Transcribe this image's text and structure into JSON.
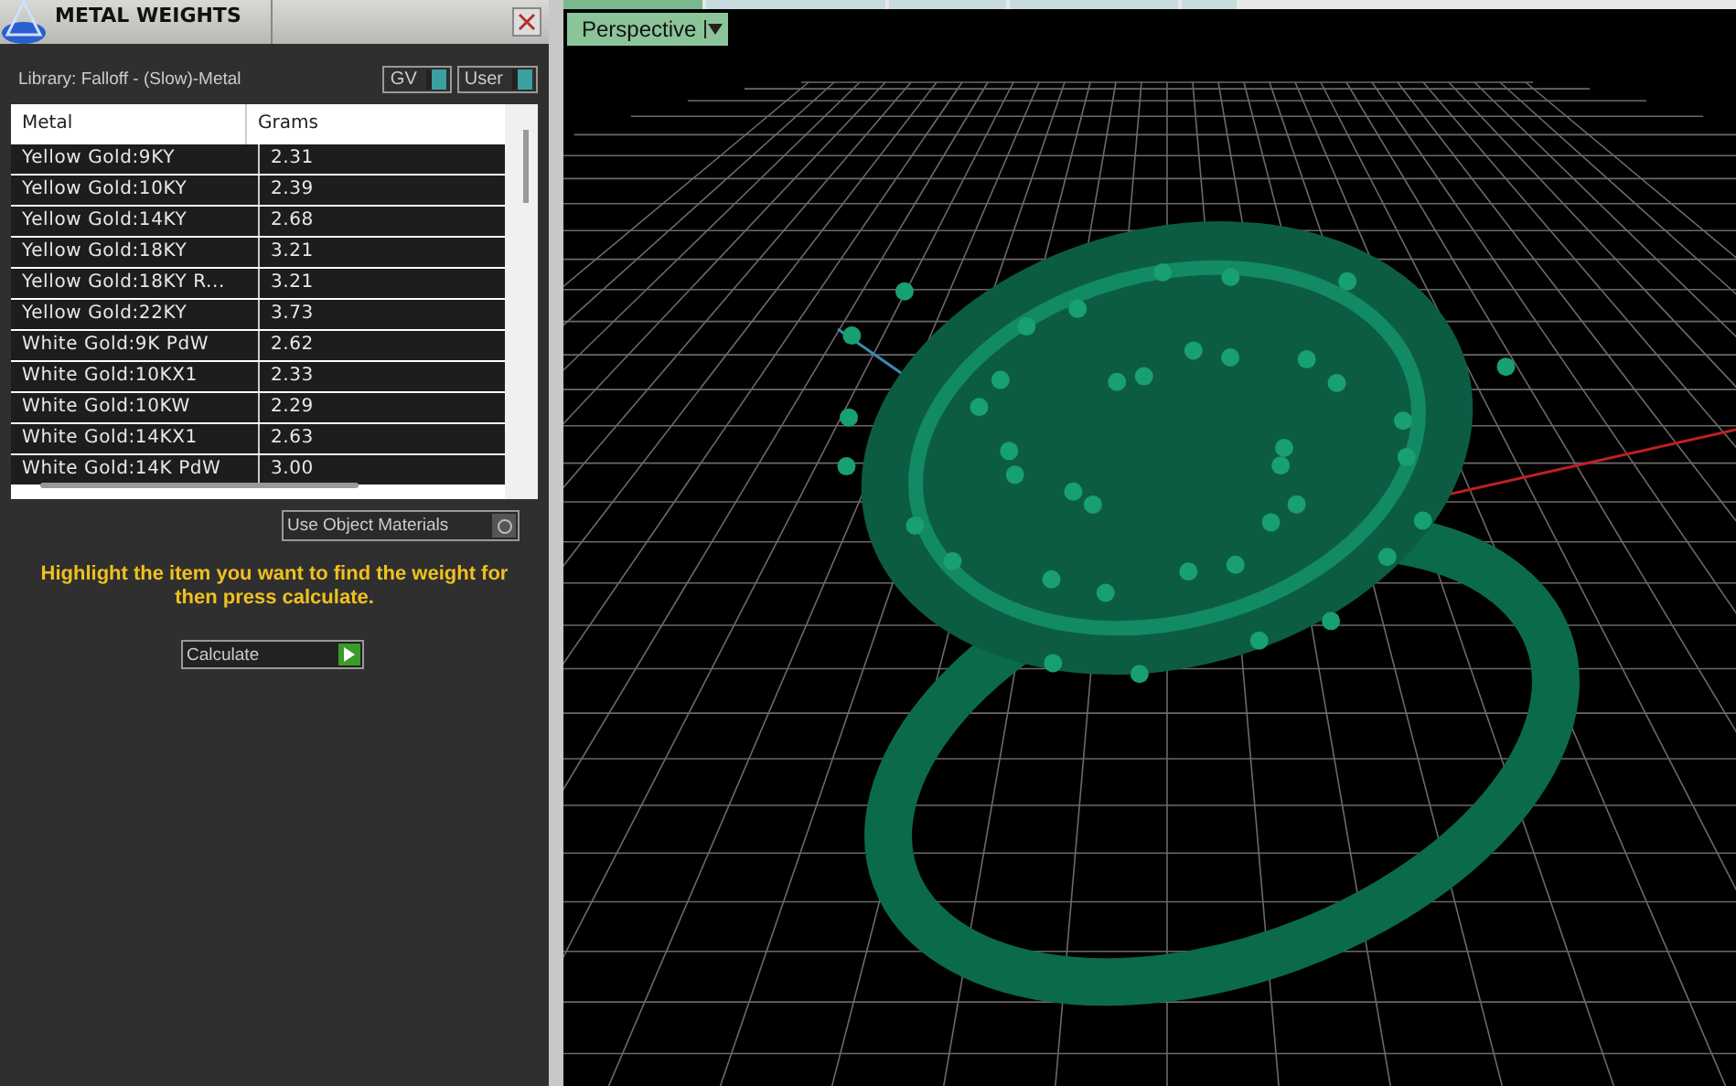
{
  "panel": {
    "title": "METAL WEIGHTS",
    "library": "Library: Falloff - (Slow)-Metal",
    "toggles": [
      {
        "label": "GV",
        "on": true
      },
      {
        "label": "User",
        "on": true
      }
    ],
    "table": {
      "columns": [
        "Metal",
        "Grams"
      ],
      "rows": [
        [
          "Yellow Gold:9KY",
          "2.31"
        ],
        [
          "Yellow Gold:10KY",
          "2.39"
        ],
        [
          "Yellow Gold:14KY",
          "2.68"
        ],
        [
          "Yellow Gold:18KY",
          "3.21"
        ],
        [
          "Yellow Gold:18KY R...",
          "3.21"
        ],
        [
          "Yellow Gold:22KY",
          "3.73"
        ],
        [
          "White Gold:9K PdW",
          "2.62"
        ],
        [
          "White Gold:10KX1",
          "2.33"
        ],
        [
          "White Gold:10KW",
          "2.29"
        ],
        [
          "White Gold:14KX1",
          "2.63"
        ],
        [
          "White Gold:14K PdW",
          "3.00"
        ]
      ]
    },
    "use_object_materials": {
      "label": "Use Object Materials"
    },
    "instruction": "Highlight the item you want to find the weight for then press calculate.",
    "calculate_button": "Calculate"
  },
  "viewport": {
    "tabs": [
      {
        "selected": true
      },
      {
        "selected": false
      },
      {
        "selected": false
      },
      {
        "selected": false
      },
      {
        "selected": false
      }
    ],
    "view_menu": "Perspective"
  }
}
